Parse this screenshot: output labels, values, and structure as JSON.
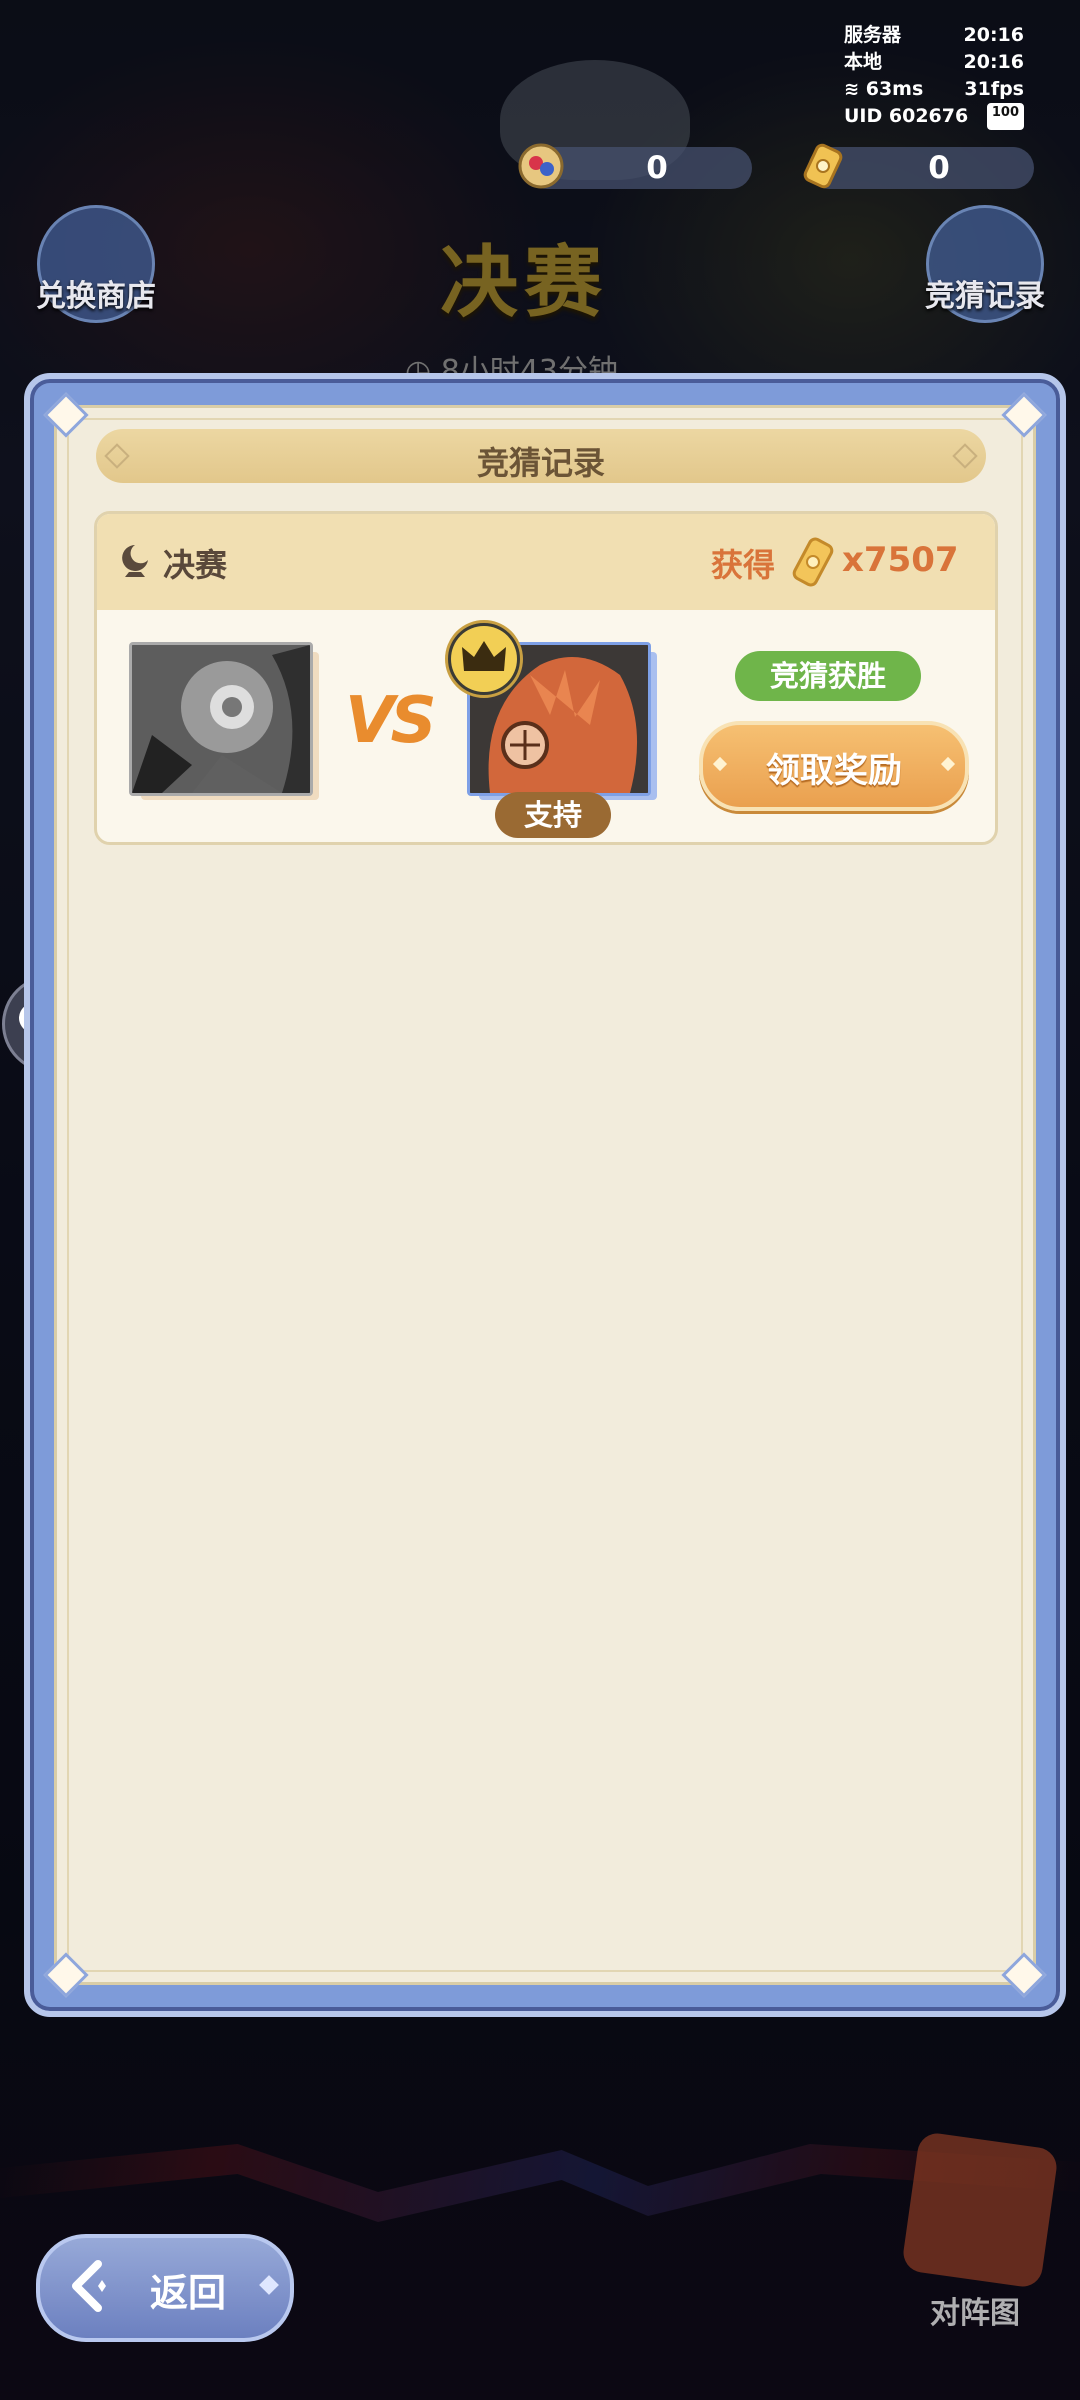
{
  "status": {
    "server_label": "服务器",
    "server_time": "20:16",
    "local_label": "本地",
    "local_time": "20:16",
    "ping": "63ms",
    "fps": "31fps",
    "uid": "UID 602676",
    "battery": "100"
  },
  "currencies": [
    {
      "icon": "gem-currency-icon",
      "value": "0"
    },
    {
      "icon": "ticket-currency-icon",
      "value": "0"
    }
  ],
  "background": {
    "exchange_shop": "兑换商店",
    "title": "决赛",
    "timer": "8小时43分钟",
    "guess_records": "竞猜记录",
    "formation": "对阵图"
  },
  "modal": {
    "title": "竞猜记录",
    "record": {
      "stage": "决赛",
      "get_label": "获得",
      "amount": "x7507",
      "vs": "VS",
      "support_label": "支持",
      "result": "竞猜获胜",
      "claim_label": "领取奖励"
    }
  },
  "back_button": {
    "label": "返回"
  },
  "colors": {
    "panel_blue": "#7e9bd9",
    "panel_cream": "#f2ecdc",
    "accent_orange": "#d9743a",
    "win_green": "#6fb54a",
    "claim_orange": "#eaa04f"
  }
}
